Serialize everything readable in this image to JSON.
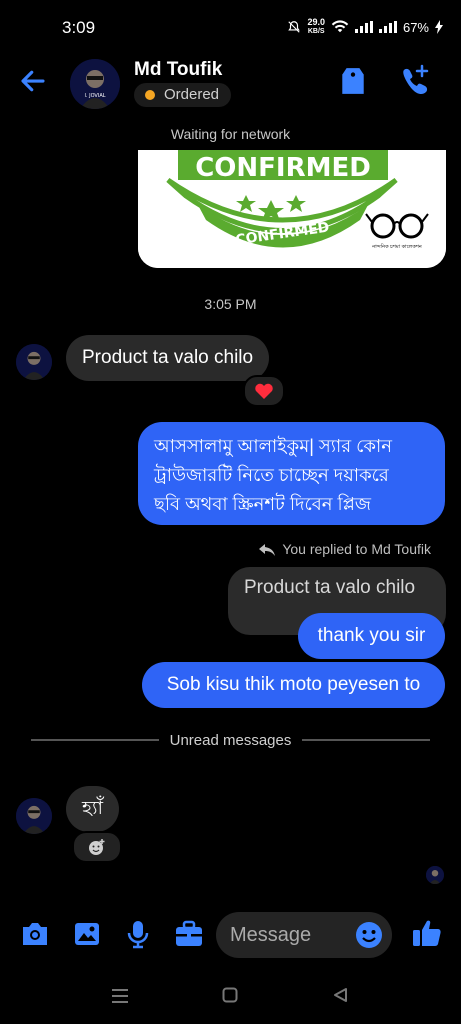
{
  "status_bar": {
    "time": "3:09",
    "net_speed_value": "29.0",
    "net_speed_unit": "KB/S",
    "battery": "67%"
  },
  "header": {
    "contact_name": "Md Toufik",
    "status": "Ordered"
  },
  "network_notice": "Waiting for network",
  "image_card": {
    "text_top": "CONFIRMED",
    "text_bottom": "CONFIRMED",
    "logo_caption": "নান্দনিক চশমা কালেকশন"
  },
  "timestamp": "3:05 PM",
  "messages": [
    {
      "id": "m1",
      "direction": "in",
      "text": "Product ta valo chilo",
      "reaction": "❤️"
    },
    {
      "id": "m2",
      "direction": "out",
      "lines": [
        "আসসালামু আলাইকুম| স্যার কোন",
        "ট্রাউজারটি নিতে চাচ্ছেন দয়াকরে",
        "ছবি অথবা স্ক্রিনশট দিবেন প্লিজ"
      ]
    },
    {
      "id": "m3",
      "direction": "out",
      "replied_label": "You replied to Md Toufik",
      "quoted": "Product ta valo chilo",
      "text": "thank you sir"
    },
    {
      "id": "m4",
      "direction": "out",
      "text": "Sob kisu thik moto peyesen to"
    },
    {
      "id": "m5",
      "direction": "in",
      "text": "হ্যাঁ"
    }
  ],
  "unread_divider": "Unread messages",
  "composer": {
    "placeholder": "Message"
  },
  "colors": {
    "accent": "#3b82ff",
    "outgoing_bubble": "#2f64f6",
    "incoming_bubble": "#2a2a2a",
    "status_dot": "#f5a623"
  },
  "icons": [
    "back-arrow-icon",
    "tag-icon",
    "call-add-icon",
    "heart-icon",
    "reply-icon",
    "add-reaction-icon",
    "camera-icon",
    "gallery-icon",
    "mic-icon",
    "briefcase-icon",
    "emoji-icon",
    "like-icon",
    "nav-menu-icon",
    "nav-home-icon",
    "nav-back-icon"
  ]
}
